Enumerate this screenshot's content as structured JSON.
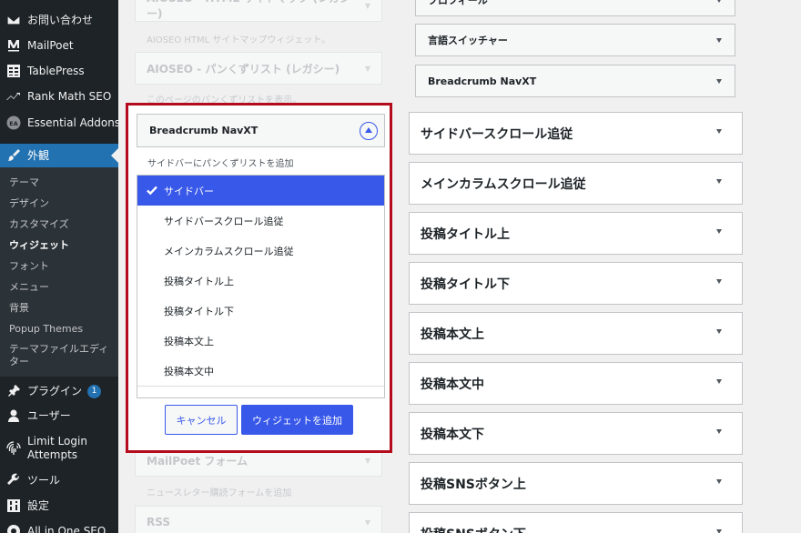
{
  "sidebar": {
    "items": [
      {
        "label": "お問い合わせ",
        "icon": "envelope-icon"
      },
      {
        "label": "MailPoet",
        "icon": "mailpoet-icon"
      },
      {
        "label": "TablePress",
        "icon": "table-icon"
      },
      {
        "label": "Rank Math SEO",
        "icon": "rank-math-icon"
      },
      {
        "label": "Essential Addons",
        "icon": "essential-addons-icon"
      },
      {
        "label": "外観",
        "icon": "brush-icon"
      },
      {
        "label": "プラグイン",
        "icon": "plugin-icon",
        "badge": "1"
      },
      {
        "label": "ユーザー",
        "icon": "user-icon"
      },
      {
        "label": "Limit Login",
        "label2": "Attempts",
        "icon": "fingerprint-icon"
      },
      {
        "label": "ツール",
        "icon": "wrench-icon"
      },
      {
        "label": "設定",
        "icon": "settings-icon"
      },
      {
        "label": "All in One SEO",
        "icon": "aioseo-icon"
      }
    ],
    "submenu": [
      {
        "label": "テーマ"
      },
      {
        "label": "デザイン"
      },
      {
        "label": "カスタマイズ"
      },
      {
        "label": "ウィジェット"
      },
      {
        "label": "フォント"
      },
      {
        "label": "メニュー"
      },
      {
        "label": "背景"
      },
      {
        "label": "Popup Themes"
      },
      {
        "label": "テーマファイルエディ",
        "label2": "ター"
      }
    ]
  },
  "available_widgets": {
    "items": [
      {
        "title": "AIOSEO - HTML サイトマップ (レガシー)",
        "desc": "AIOSEO HTML サイトマップウィジェット。"
      },
      {
        "title": "AIOSEO - パンくずリスト (レガシー)",
        "desc": "このページのパンくずリストを表示。"
      },
      {
        "title": "MailPoet フォーム",
        "desc": "ニュースレター購読フォームを追加"
      },
      {
        "title": "RSS",
        "desc": ""
      }
    ]
  },
  "chooser": {
    "widget_title": "Breadcrumb NavXT",
    "description": "サイドバーにパンくずリストを追加",
    "options": [
      "サイドバー",
      "サイドバースクロール追従",
      "メインカラムスクロール追従",
      "投稿タイトル上",
      "投稿タイトル下",
      "投稿本文上",
      "投稿本文中"
    ],
    "selected_index": 0,
    "cancel_label": "キャンセル",
    "add_label": "ウィジェットを追加"
  },
  "widget_areas": {
    "inner_widgets": [
      "プロフィール",
      "言語スイッチャー",
      "Breadcrumb NavXT"
    ],
    "areas": [
      "サイドバースクロール追従",
      "メインカラムスクロール追従",
      "投稿タイトル上",
      "投稿タイトル下",
      "投稿本文上",
      "投稿本文中",
      "投稿本文下",
      "投稿SNSボタン上",
      "投稿SNSボタン下"
    ]
  },
  "colors": {
    "admin_bar": "#1d2327",
    "accent": "#2271b1",
    "selection": "#3858e9",
    "highlight_border": "#b40b1d"
  }
}
